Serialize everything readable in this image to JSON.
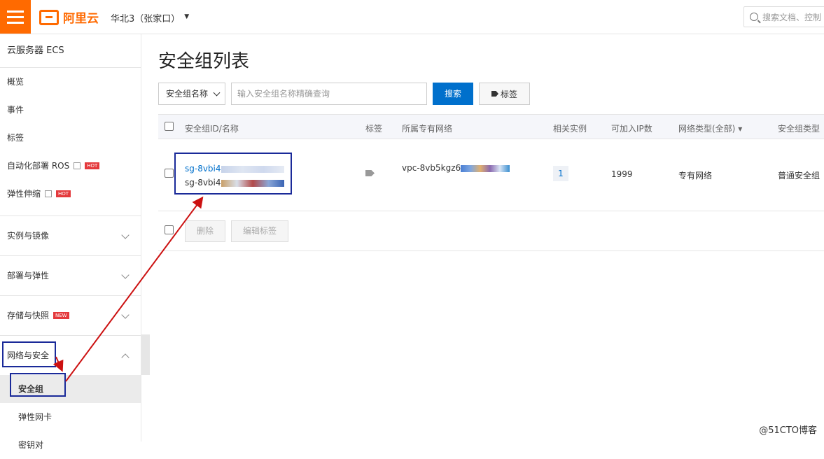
{
  "header": {
    "logo_text": "阿里云",
    "region": "华北3（张家口）",
    "search_placeholder": "搜索文档、控制"
  },
  "sidebar": {
    "title": "云服务器 ECS",
    "items": [
      {
        "label": "概览"
      },
      {
        "label": "事件"
      },
      {
        "label": "标签"
      },
      {
        "label": "自动化部署 ROS",
        "badge": "HOT"
      },
      {
        "label": "弹性伸缩",
        "badge": "HOT"
      }
    ],
    "groups": [
      {
        "label": "实例与镜像"
      },
      {
        "label": "部署与弹性"
      },
      {
        "label": "存储与快照",
        "badge": "NEW"
      },
      {
        "label": "网络与安全"
      }
    ],
    "network_sub": [
      {
        "label": "安全组"
      },
      {
        "label": "弹性网卡"
      },
      {
        "label": "密钥对"
      }
    ]
  },
  "main": {
    "title": "安全组列表",
    "filter_select": "安全组名称",
    "filter_placeholder": "输入安全组名称精确查询",
    "search_button": "搜索",
    "tag_button": "标签",
    "columns": [
      "安全组ID/名称",
      "标签",
      "所属专有网络",
      "相关实例",
      "可加入IP数",
      "网络类型(全部)",
      "安全组类型"
    ],
    "rows": [
      {
        "id": "sg-8vbi4",
        "name": "sg-8vbi4",
        "vpc": "vpc-8vb5kgz6",
        "instances": "1",
        "ip_count": "1999",
        "network_type": "专有网络",
        "group_type": "普通安全组"
      }
    ],
    "delete_button": "删除",
    "edit_tags_button": "编辑标签"
  },
  "watermark": "@51CTO博客",
  "colors": {
    "brand": "#ff6a00",
    "primary": "#0070cc",
    "highlight": "#1a2a99",
    "arrow": "#cc1111"
  }
}
